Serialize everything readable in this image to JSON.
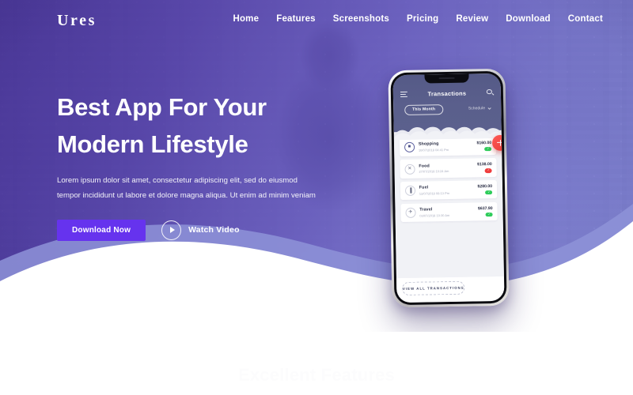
{
  "navbar": {
    "brand": "Ures",
    "links": [
      {
        "label": "Home"
      },
      {
        "label": "Features"
      },
      {
        "label": "Screenshots"
      },
      {
        "label": "Pricing"
      },
      {
        "label": "Review"
      },
      {
        "label": "Download"
      },
      {
        "label": "Contact"
      }
    ]
  },
  "hero": {
    "title_line1": "Best App For Your",
    "title_line2": "Modern Lifestyle",
    "subtitle": "Lorem ipsum dolor sit amet, consectetur adipiscing elit, sed do eiusmod tempor incididunt ut labore et dolore magna aliqua. Ut enim ad minim veniam",
    "download_label": "Download Now",
    "watch_video_label": "Watch Video",
    "play_icon": "play-icon"
  },
  "phone": {
    "app_title": "Transactions",
    "menu_icon": "hamburger-icon",
    "search_icon": "search-icon",
    "filter_this_month": "This Month",
    "filter_schedule": "Schedule",
    "fab_icon": "plus-icon",
    "view_all_label": "VIEW ALL TRANSACTIONS",
    "transactions": [
      {
        "name": "Shopping",
        "date": "10/07/2018 04:41 Pm",
        "amount": "$160.00",
        "status": "ok",
        "status_glyph": "✓",
        "icon": "shopping-bag-icon",
        "icon_glyph": "■"
      },
      {
        "name": "Food",
        "date": "27/07/2018 10:24 Am",
        "amount": "$138.00",
        "status": "fail",
        "status_glyph": "✓",
        "icon": "cutlery-icon",
        "icon_glyph": "✕"
      },
      {
        "name": "Fuel",
        "date": "12/07/2018 08:13 Pm",
        "amount": "$280.00",
        "status": "ok",
        "status_glyph": "✓",
        "icon": "fuel-pump-icon",
        "icon_glyph": "▐"
      },
      {
        "name": "Travel",
        "date": "03/07/2018 10:30 Am",
        "amount": "$637.90",
        "status": "ok",
        "status_glyph": "✓",
        "icon": "airplane-icon",
        "icon_glyph": "✈"
      }
    ]
  },
  "features": {
    "title": "Excellent Features"
  },
  "colors": {
    "accent": "#6633ee",
    "hero_gradient_start": "#493598",
    "hero_gradient_end": "#868bdd",
    "wave_light": "#8e93d8",
    "status_ok": "#2ecc5a",
    "status_fail": "#ef3d3d",
    "fab": "#e83b37"
  }
}
